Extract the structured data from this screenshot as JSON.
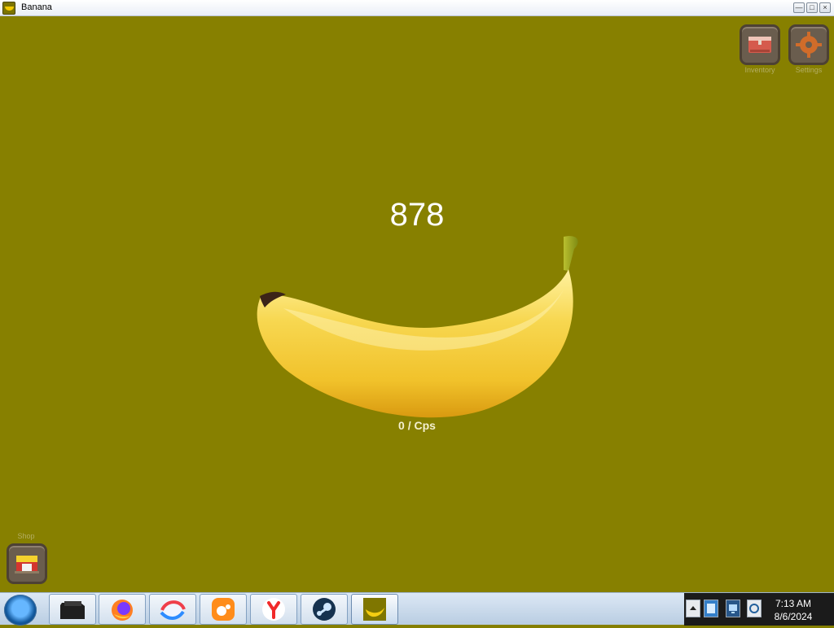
{
  "window": {
    "title": "Banana",
    "minimize": "—",
    "restore": "□",
    "close": "×"
  },
  "game": {
    "count": "878",
    "cps": "0 / Cps",
    "inventory_label": "Inventory",
    "settings_label": "Settings",
    "shop_label": "Shop",
    "colors": {
      "background": "#878000",
      "counter": "#ffffff",
      "button": "#6a5d4e"
    }
  },
  "taskbar": {
    "start_icon": "windows-start-icon",
    "apps": [
      {
        "name": "dark-folder-icon"
      },
      {
        "name": "firefox-icon"
      },
      {
        "name": "orbit-browser-icon"
      },
      {
        "name": "uc-browser-icon"
      },
      {
        "name": "yandex-browser-icon"
      },
      {
        "name": "steam-icon"
      },
      {
        "name": "banana-icon"
      }
    ],
    "clock": {
      "time": "7:13 AM",
      "date": "8/6/2024"
    }
  }
}
